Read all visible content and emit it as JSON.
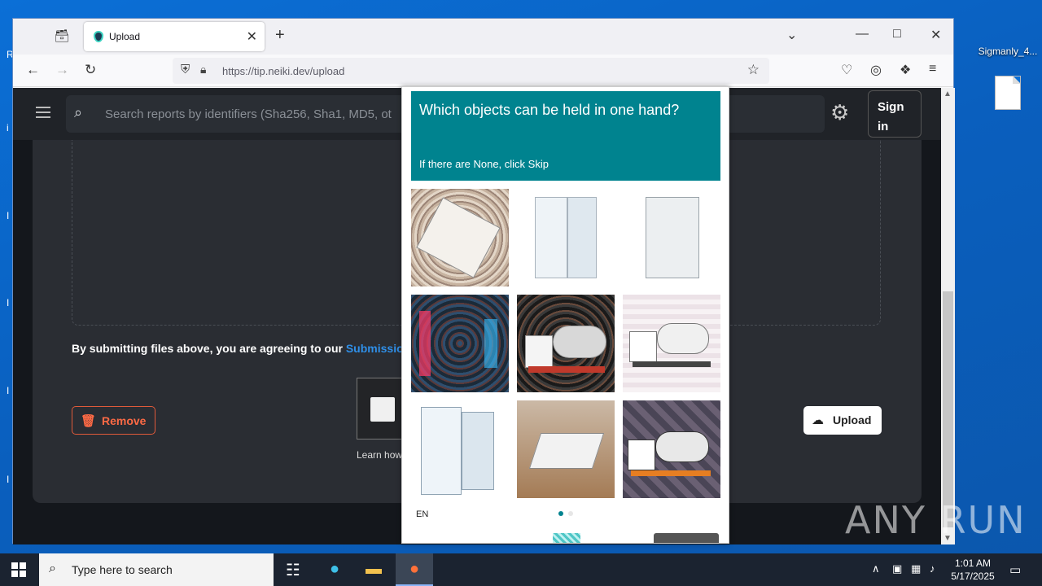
{
  "desktop": {
    "file_icon_label": "Sigmanly_4...",
    "watermark": "ANY RUN"
  },
  "browser": {
    "tab": {
      "title": "Upload"
    },
    "url": "https://tip.neiki.dev/upload"
  },
  "site": {
    "search_placeholder": "Search reports by identifiers (Sha256, Sha1, MD5, ot",
    "sign_in_label": "Sign in",
    "terms_text": "By submitting files above, you are agreeing to our ",
    "terms_link": "Submission",
    "remove_label": "Remove",
    "upload_label": "Upload",
    "learn_text": "Learn how"
  },
  "captcha": {
    "question": "Which objects can be held in one hand?",
    "hint": "If there are None, click Skip",
    "language": "EN",
    "tiles": [
      "tablet-on-patterned-background",
      "open-refrigerator",
      "open-refrigerator",
      "city-street-with-patterned-overlay",
      "cement-mixer-truck",
      "cement-mixer-truck",
      "open-refrigerator",
      "tablet-on-table",
      "cement-mixer-truck"
    ],
    "accent_color": "#00838f"
  },
  "taskbar": {
    "search_placeholder": "Type here to search",
    "time": "1:01 AM",
    "date": "5/17/2025"
  }
}
